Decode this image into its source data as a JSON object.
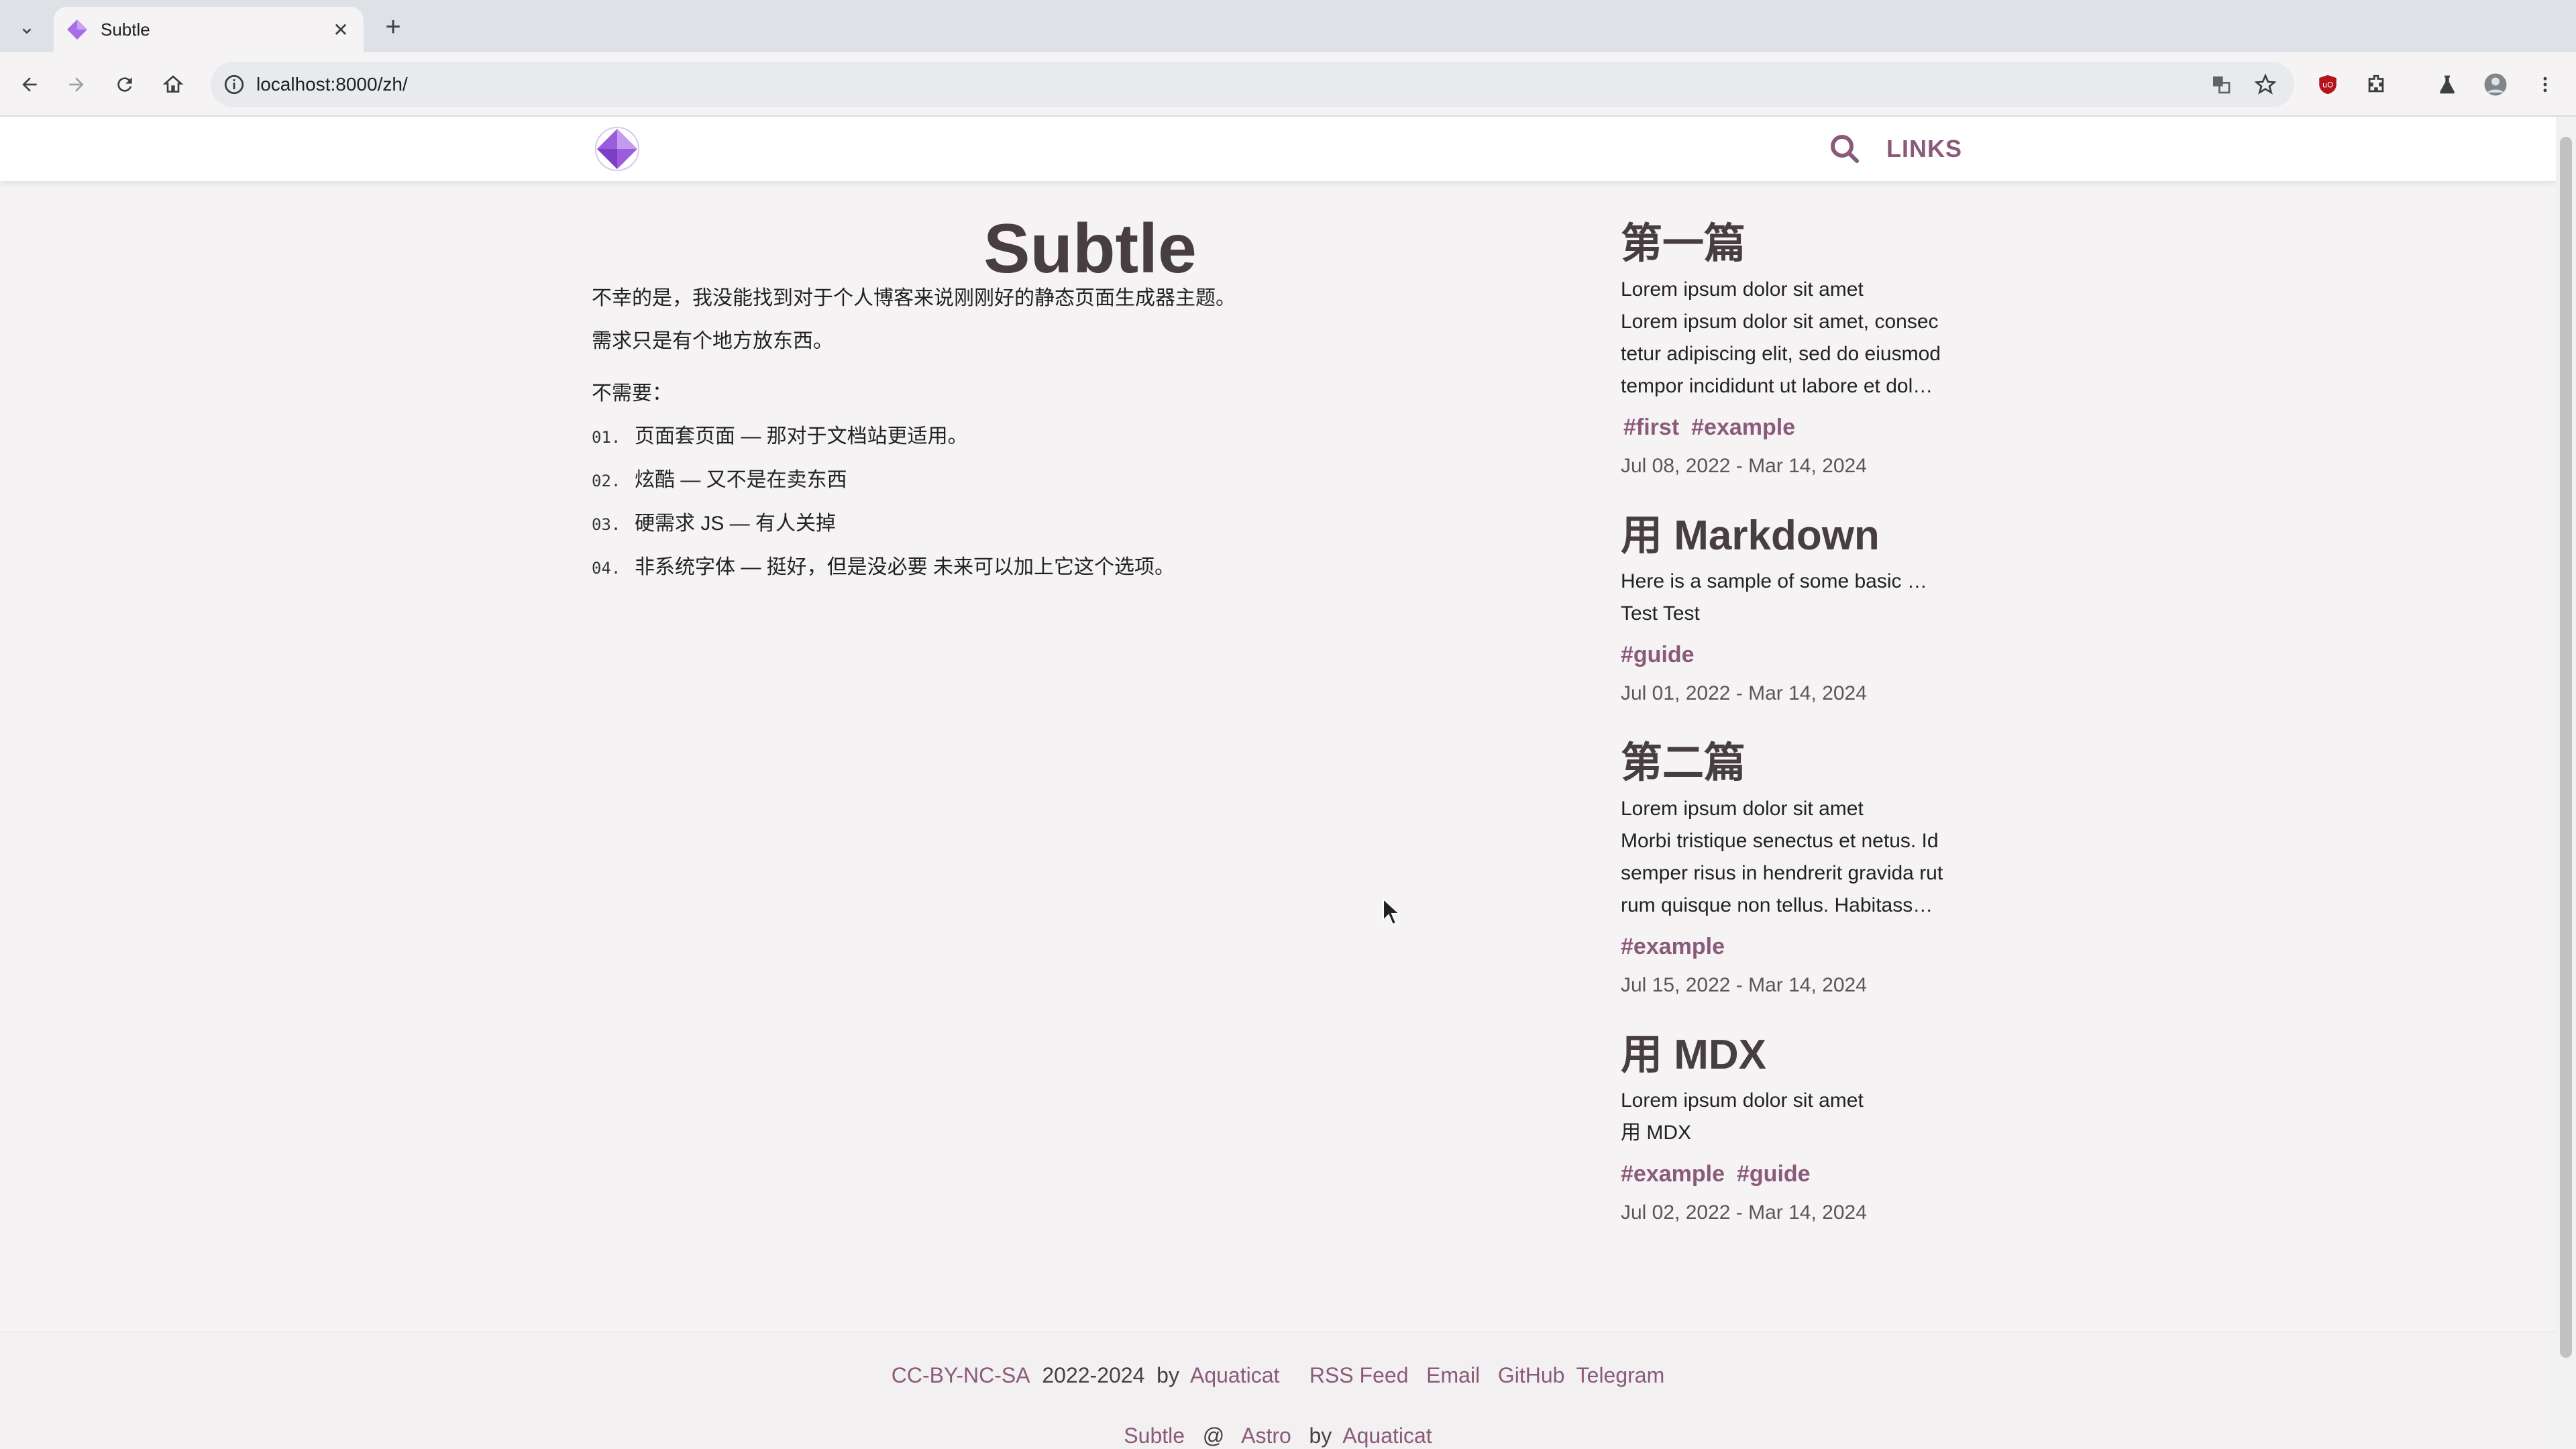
{
  "browser": {
    "tab_title": "Subtle",
    "url": "localhost:8000/zh/"
  },
  "site": {
    "nav_links": "LINKS",
    "title": "Subtle",
    "intro_1": "不幸的是，我没能找到对于个人博客来说刚刚好的静态页面生成器主题。",
    "intro_2": "需求只是有个地方放东西。",
    "no_need": "不需要：",
    "list": [
      {
        "num": "01.",
        "text": "页面套页面 — 那对于文档站更适用。"
      },
      {
        "num": "02.",
        "text": "炫酷 — 又不是在卖东西"
      },
      {
        "num": "03.",
        "text": "硬需求 JS — 有人关掉"
      },
      {
        "num": "04.",
        "text": "非系统字体 — 挺好，但是没必要 未来可以加上它这个选项。"
      }
    ]
  },
  "posts": [
    {
      "title": "第一篇",
      "subtitle": "Lorem ipsum dolor sit amet",
      "excerpt_lines": [
        "Lorem ipsum dolor sit amet, consec",
        "tetur adipiscing elit, sed do eiusmod",
        "tempor incididunt ut labore et dol…"
      ],
      "tags": [
        "#first",
        "#example"
      ],
      "date": "Jul 08, 2022 - Mar 14, 2024"
    },
    {
      "title": "用 Markdown",
      "subtitle": "Here is a sample of some basic …",
      "excerpt_lines": [
        "Test Test"
      ],
      "tags": [
        "#guide"
      ],
      "date": "Jul 01, 2022 - Mar 14, 2024"
    },
    {
      "title": "第二篇",
      "subtitle": "Lorem ipsum dolor sit amet",
      "excerpt_lines": [
        "Morbi tristique senectus et netus. Id",
        "semper risus in hendrerit gravida rut",
        "rum quisque non tellus. Habitass…"
      ],
      "tags": [
        "#example"
      ],
      "date": "Jul 15, 2022 - Mar 14, 2024"
    },
    {
      "title": "用 MDX",
      "subtitle": "Lorem ipsum dolor sit amet",
      "excerpt_lines": [
        "用 MDX"
      ],
      "tags": [
        "#example",
        "#guide"
      ],
      "date": "Jul 02, 2022 - Mar 14, 2024"
    }
  ],
  "footer": {
    "license": "CC-BY-NC-SA",
    "years": "2022-2024",
    "by": "by",
    "author": "Aquaticat",
    "rss": "RSS Feed",
    "email": "Email",
    "github": "GitHub",
    "telegram": "Telegram",
    "row2_site": "Subtle",
    "row2_at": "@",
    "row2_astro": "Astro",
    "row2_by": "by",
    "row2_author": "Aquaticat"
  },
  "colors": {
    "accent": "#8a5a7a",
    "heading": "#463e42",
    "background": "#f6f3f4"
  }
}
